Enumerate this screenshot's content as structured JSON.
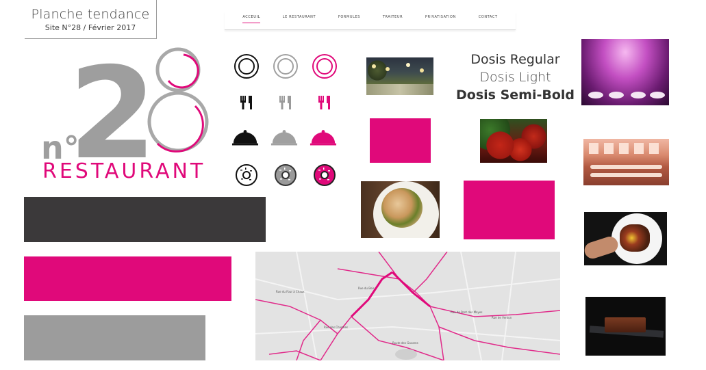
{
  "header": {
    "title": "Planche tendance",
    "subtitle": "Site N°28 / Février 2017"
  },
  "nav": {
    "items": [
      "ACCEUIL",
      "LE RESTAURANT",
      "FORMULES",
      "TRAITEUR",
      "PRIVATISATION",
      "CONTACT"
    ],
    "active_index": 0
  },
  "logo": {
    "prefix": "n°",
    "number_left": "2",
    "number_right": "8",
    "word": "RESTAURANT"
  },
  "typography": {
    "samples": [
      "Dosis Regular",
      "Dosis Light",
      "Dosis Semi-Bold"
    ]
  },
  "palette": {
    "dark": "#3b393a",
    "pink": "#e0097a",
    "gray": "#9c9c9c",
    "light_gray": "#a0a0a0",
    "black": "#111111"
  },
  "icons": {
    "rows": [
      {
        "name": "plate-icon",
        "variants": [
          "black",
          "gray",
          "pink"
        ]
      },
      {
        "name": "cutlery-icon",
        "variants": [
          "black",
          "gray",
          "pink"
        ]
      },
      {
        "name": "cloche-icon",
        "variants": [
          "black",
          "gray",
          "pink"
        ]
      },
      {
        "name": "donut-icon",
        "variants": [
          "black",
          "gray",
          "pink"
        ]
      }
    ]
  },
  "map": {
    "streets": [
      "Rue du Four à Chaux",
      "Rue des Charmes",
      "Rue du Bois",
      "Rue de Pont des Mayes",
      "Rue de Verdun",
      "Route des Gavares"
    ]
  }
}
